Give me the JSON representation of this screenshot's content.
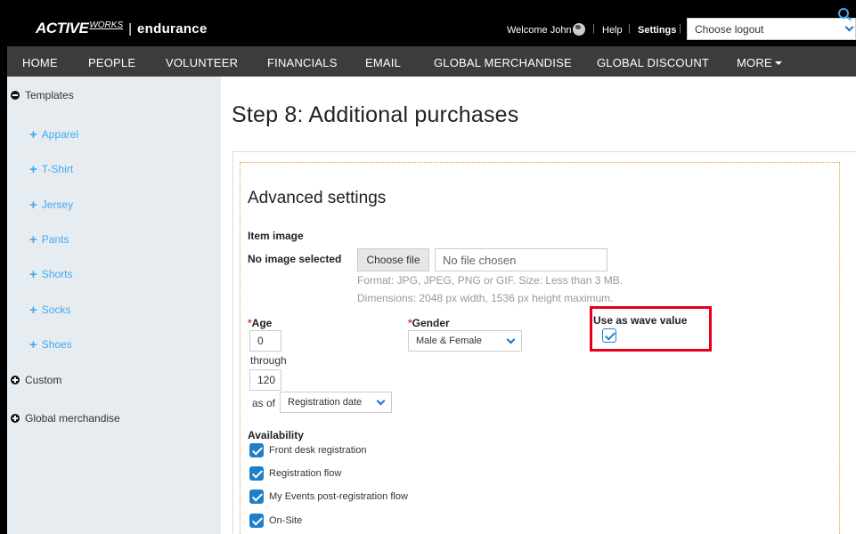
{
  "header": {
    "logo_brand": "ACTIVE",
    "logo_sub": "WORKS",
    "logo_separator": "|",
    "logo_product": "endurance",
    "welcome": "Welcome John",
    "help": "Help",
    "settings": "Settings",
    "logout_placeholder": "Choose logout"
  },
  "nav": {
    "items": [
      "HOME",
      "PEOPLE",
      "VOLUNTEER",
      "FINANCIALS",
      "EMAIL",
      "GLOBAL MERCHANDISE",
      "GLOBAL DISCOUNT",
      "MORE"
    ]
  },
  "sidebar": {
    "templates_label": "Templates",
    "template_items": [
      "Apparel",
      "T-Shirt",
      "Jersey",
      "Pants",
      "Shorts",
      "Socks",
      "Shoes"
    ],
    "custom_label": "Custom",
    "global_label": "Global merchandise"
  },
  "main": {
    "title": "Step 8: Additional purchases",
    "section_title": "Advanced settings",
    "item_image_label": "Item image",
    "no_image_label": "No image selected",
    "choose_file_button": "Choose file",
    "file_field_text": "No file chosen",
    "format_hint": "Format: JPG, JPEG, PNG or GIF. Size: Less than 3 MB.",
    "dimension_hint": "Dimensions: 2048 px width, 1536 px height maximum.",
    "age_label": "Age",
    "age_from": "0",
    "through_label": "through",
    "age_to": "120",
    "as_of_label": "as of",
    "as_of_value": "Registration date",
    "gender_label": "Gender",
    "gender_value": "Male & Female",
    "wave_label": "Use as wave value",
    "wave_checked": true,
    "availability_label": "Availability",
    "availability_options": [
      {
        "label": "Front desk registration",
        "checked": true
      },
      {
        "label": "Registration flow",
        "checked": true
      },
      {
        "label": "My Events post-registration flow",
        "checked": true
      },
      {
        "label": "On-Site",
        "checked": true
      }
    ]
  },
  "colors": {
    "accent": "#3fa9f5",
    "checkbox": "#1f7fc7",
    "highlight": "#e4001b",
    "required": "#ee3344"
  }
}
